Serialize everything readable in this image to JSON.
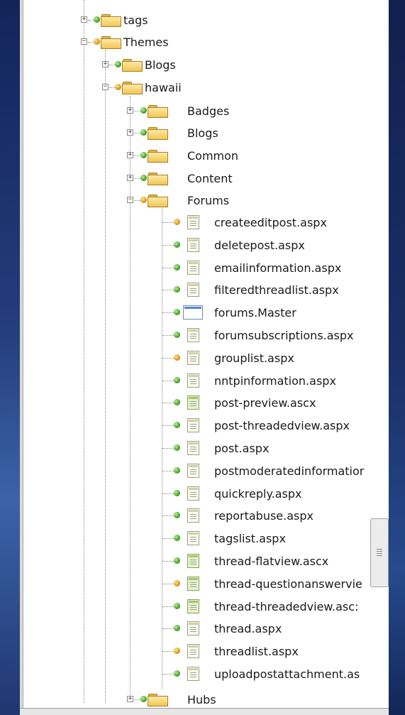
{
  "tree": {
    "tags": "tags",
    "themes": "Themes",
    "blogs_top": "Blogs",
    "hawaii": "hawaii",
    "folders_before": [
      "Badges",
      "Blogs",
      "Common",
      "Content"
    ],
    "forums": "Forums",
    "forum_files": [
      {
        "name": "createeditpost.aspx",
        "dot": "orange",
        "icon": "aspx-file-icon"
      },
      {
        "name": "deletepost.aspx",
        "dot": "green",
        "icon": "aspx-file-icon"
      },
      {
        "name": "emailinformation.aspx",
        "dot": "green",
        "icon": "aspx-file-icon"
      },
      {
        "name": "filteredthreadlist.aspx",
        "dot": "green",
        "icon": "aspx-file-icon"
      },
      {
        "name": "forums.Master",
        "dot": "green",
        "icon": "master-file-icon"
      },
      {
        "name": "forumsubscriptions.aspx",
        "dot": "green",
        "icon": "aspx-file-icon"
      },
      {
        "name": "grouplist.aspx",
        "dot": "orange",
        "icon": "aspx-file-icon"
      },
      {
        "name": "nntpinformation.aspx",
        "dot": "green",
        "icon": "aspx-file-icon"
      },
      {
        "name": "post-preview.ascx",
        "dot": "green",
        "icon": "ascx-file-icon"
      },
      {
        "name": "post-threadedview.aspx",
        "dot": "green",
        "icon": "aspx-file-icon"
      },
      {
        "name": "post.aspx",
        "dot": "green",
        "icon": "aspx-file-icon"
      },
      {
        "name": "postmoderatedinformatior",
        "dot": "green",
        "icon": "aspx-file-icon"
      },
      {
        "name": "quickreply.aspx",
        "dot": "green",
        "icon": "aspx-file-icon"
      },
      {
        "name": "reportabuse.aspx",
        "dot": "green",
        "icon": "aspx-file-icon"
      },
      {
        "name": "tagslist.aspx",
        "dot": "green",
        "icon": "aspx-file-icon"
      },
      {
        "name": "thread-flatview.ascx",
        "dot": "green",
        "icon": "ascx-file-icon"
      },
      {
        "name": "thread-questionanswervie",
        "dot": "orange",
        "icon": "ascx-file-icon"
      },
      {
        "name": "thread-threadedview.asc:",
        "dot": "green",
        "icon": "ascx-file-icon"
      },
      {
        "name": "thread.aspx",
        "dot": "green",
        "icon": "aspx-file-icon"
      },
      {
        "name": "threadlist.aspx",
        "dot": "orange",
        "icon": "aspx-file-icon"
      },
      {
        "name": "uploadpostattachment.as",
        "dot": "green",
        "icon": "aspx-file-icon"
      }
    ],
    "hubs": "Hubs"
  },
  "colors": {
    "green_status": "#4faa2e",
    "orange_status": "#e0a020",
    "folder": "#f1c552"
  }
}
